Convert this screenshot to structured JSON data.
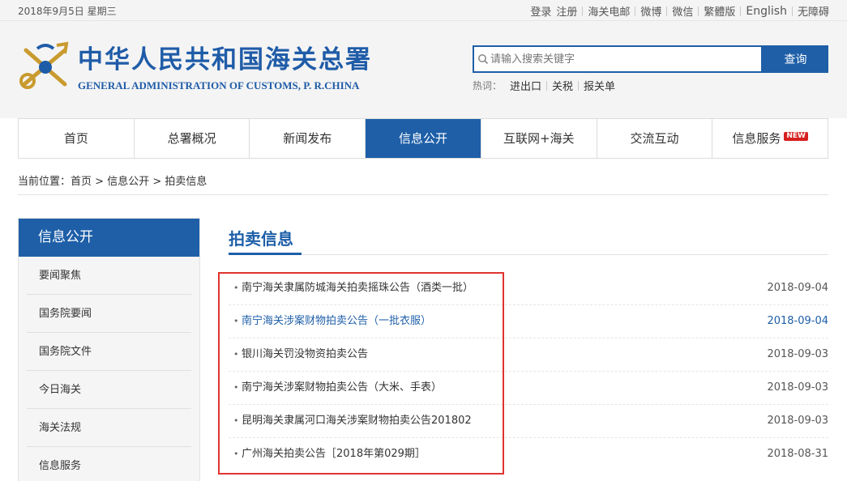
{
  "topbar": {
    "date": "2018年9月5日 星期三",
    "links": [
      "登录",
      "注册",
      "海关电邮",
      "微博",
      "微信",
      "繁體版",
      "English",
      "无障碍"
    ]
  },
  "header": {
    "title_cn": "中华人民共和国海关总署",
    "title_en": "GENERAL ADMINISTRATION OF CUSTOMS, P. R.CHINA",
    "search": {
      "placeholder": "请输入搜索关键字",
      "button": "查询"
    },
    "hot": {
      "label": "热词：",
      "items": [
        "进出口",
        "关税",
        "报关单"
      ]
    }
  },
  "nav": {
    "items": [
      "首页",
      "总署概况",
      "新闻发布",
      "信息公开",
      "互联网+海关",
      "交流互动",
      "信息服务"
    ],
    "active_index": 3,
    "new_badge": "NEW"
  },
  "breadcrumb": {
    "label": "当前位置：",
    "items": [
      "首页",
      "信息公开",
      "拍卖信息"
    ],
    "separator": " > "
  },
  "sidebar": {
    "title": "信息公开",
    "items": [
      "要闻聚焦",
      "国务院要闻",
      "国务院文件",
      "今日海关",
      "海关法规",
      "信息服务"
    ]
  },
  "main": {
    "title": "拍卖信息",
    "news": [
      {
        "title": "南宁海关隶属防城海关拍卖摇珠公告（酒类一批）",
        "date": "2018-09-04"
      },
      {
        "title": "南宁海关涉案财物拍卖公告（一批衣服）",
        "date": "2018-09-04"
      },
      {
        "title": "银川海关罚没物资拍卖公告",
        "date": "2018-09-03"
      },
      {
        "title": "南宁海关涉案财物拍卖公告（大米、手表）",
        "date": "2018-09-03"
      },
      {
        "title": "昆明海关隶属河口海关涉案财物拍卖公告201802",
        "date": "2018-09-03"
      },
      {
        "title": "广州海关拍卖公告［2018年第029期］",
        "date": "2018-08-31"
      }
    ]
  },
  "colors": {
    "brand_blue": "#1e5fa8",
    "highlight_red": "#e0332f",
    "badge_red": "#d72020"
  }
}
